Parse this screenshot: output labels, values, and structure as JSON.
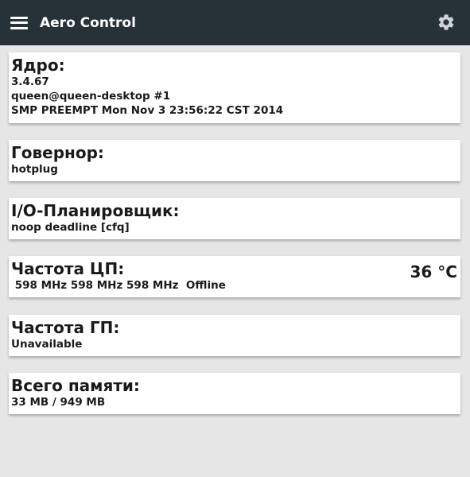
{
  "app": {
    "title": "Aero Control",
    "menu_icon": "hamburger-menu-icon",
    "settings_icon": "gear-icon",
    "colors": {
      "appbar": "#263238",
      "background": "#e6e6e6",
      "card": "#ffffff",
      "text": "#1a1a1a"
    }
  },
  "kernel": {
    "title": "Ядро:",
    "version": "3.4.67",
    "builder": "queen@queen-desktop #1",
    "build_info": "SMP PREEMPT Mon Nov 3 23:56:22 CST 2014"
  },
  "governor": {
    "title": "Говернор:",
    "value": "hotplug"
  },
  "io_scheduler": {
    "title": "I/O-Планировщик:",
    "value": "noop deadline [cfq]"
  },
  "cpu_freq": {
    "title": "Частота ЦП:",
    "value": " 598 MHz 598 MHz 598 MHz  Offline",
    "temperature": "36 °C"
  },
  "gpu_freq": {
    "title": "Частота ГП:",
    "value": "Unavailable"
  },
  "memory": {
    "title": "Всего памяти:",
    "value": "33 MB / 949 MB"
  }
}
